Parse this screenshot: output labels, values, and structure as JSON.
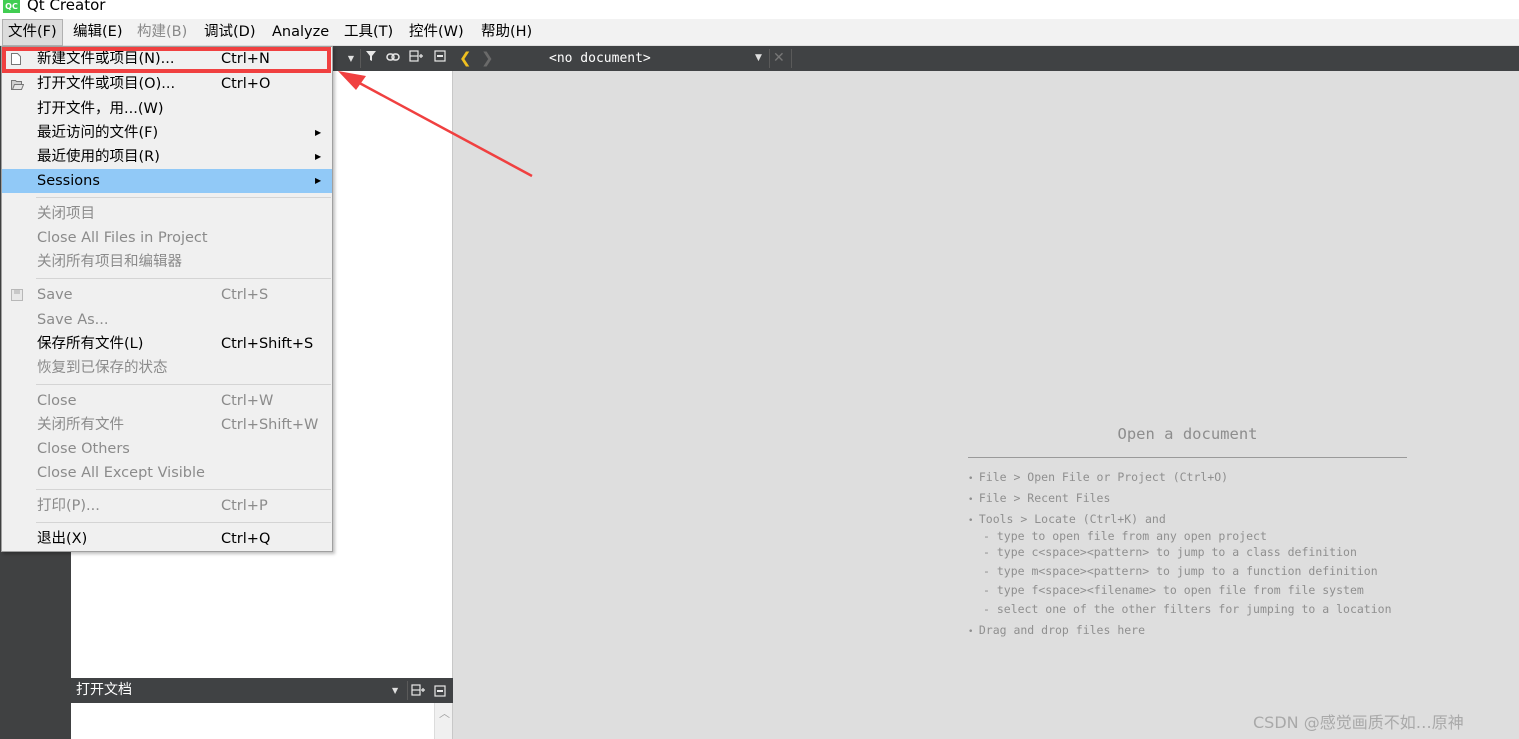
{
  "window": {
    "title": "Qt Creator",
    "icon_text": "QC"
  },
  "menubar": {
    "items": [
      {
        "label": "文件(F)"
      },
      {
        "label": "编辑(E)"
      },
      {
        "label": "构建(B)"
      },
      {
        "label": "调试(D)"
      },
      {
        "label": "Analyze"
      },
      {
        "label": "工具(T)"
      },
      {
        "label": "控件(W)"
      },
      {
        "label": "帮助(H)"
      }
    ]
  },
  "file_menu": {
    "new": {
      "label": "新建文件或项目(N)...",
      "shortcut": "Ctrl+N"
    },
    "open": {
      "label": "打开文件或项目(O)...",
      "shortcut": "Ctrl+O"
    },
    "open_with": {
      "label": "打开文件，用...(W)"
    },
    "recent_files": {
      "label": "最近访问的文件(F)"
    },
    "recent_projects": {
      "label": "最近使用的项目(R)"
    },
    "sessions": {
      "label": "Sessions"
    },
    "close_project": {
      "label": "关闭项目"
    },
    "close_all_in_project": {
      "label": "Close All Files in Project"
    },
    "close_all_projects": {
      "label": "关闭所有项目和编辑器"
    },
    "save": {
      "label": "Save",
      "shortcut": "Ctrl+S"
    },
    "save_as": {
      "label": "Save As..."
    },
    "save_all": {
      "label": "保存所有文件(L)",
      "shortcut": "Ctrl+Shift+S"
    },
    "revert": {
      "label": "恢复到已保存的状态"
    },
    "close": {
      "label": "Close",
      "shortcut": "Ctrl+W"
    },
    "close_all": {
      "label": "关闭所有文件",
      "shortcut": "Ctrl+Shift+W"
    },
    "close_others": {
      "label": "Close Others"
    },
    "close_except_visible": {
      "label": "Close All Except Visible"
    },
    "print": {
      "label": "打印(P)...",
      "shortcut": "Ctrl+P"
    },
    "exit": {
      "label": "退出(X)",
      "shortcut": "Ctrl+Q"
    }
  },
  "editor": {
    "document_combo": "<no document>",
    "placeholder": {
      "title": "Open a document",
      "lines": [
        "File > Open File or Project (Ctrl+O)",
        "File > Recent Files",
        "Tools > Locate (Ctrl+K) and",
        "- type to open file from any open project",
        "- type c<space><pattern> to jump to a class definition",
        "- type m<space><pattern> to jump to a function definition",
        "- type f<space><filename> to open file from file system",
        "- select one of the other filters for jumping to a location",
        "Drag and drop files here"
      ]
    }
  },
  "open_documents": {
    "title": "打开文档"
  },
  "watermark": "CSDN @感觉画质不如…原神",
  "colors": {
    "highlight": "#91c9f7",
    "annotation": "#f04040",
    "back_arrow": "#f0c020"
  }
}
